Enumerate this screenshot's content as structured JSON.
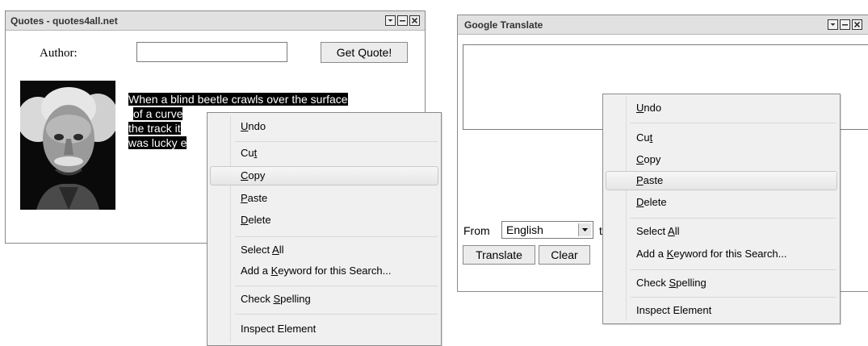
{
  "quotes_gadget": {
    "title": "Quotes - quotes4all.net",
    "author_label": "Author:",
    "author_value": "",
    "get_quote_label": "Get Quote!",
    "quote_lines": [
      "When a blind beetle crawls over the surface",
      "of a curved branch, it doesn't notice that",
      "the track it has covered is indeed curved. I",
      "was lucky enough to notice what the beetle"
    ],
    "visible_quote_lines": [
      "When a blind beetle crawls over the surface",
      " of a curve",
      "the track it",
      "was lucky e"
    ],
    "photo_alt": "portrait"
  },
  "translate_gadget": {
    "title": "Google Translate",
    "source_text": "",
    "from_label": "From",
    "from_language": "English",
    "to_label_partial": "t",
    "translate_label": "Translate",
    "clear_label": "Clear"
  },
  "context_menu_left": {
    "items": [
      {
        "label": "Undo",
        "accel": "U"
      },
      {
        "label": "Cut",
        "accel": "t"
      },
      {
        "label": "Copy",
        "accel": "C"
      },
      {
        "label": "Paste",
        "accel": "P"
      },
      {
        "label": "Delete",
        "accel": "D"
      },
      {
        "label": "Select All",
        "accel": "A"
      },
      {
        "label": "Add a Keyword for this Search...",
        "accel": "K"
      },
      {
        "label": "Check Spelling",
        "accel": "S"
      },
      {
        "label": "Inspect Element",
        "accel": ""
      }
    ],
    "highlighted": "Copy"
  },
  "context_menu_right": {
    "items": [
      {
        "label": "Undo",
        "accel": "U"
      },
      {
        "label": "Cut",
        "accel": "t"
      },
      {
        "label": "Copy",
        "accel": "C"
      },
      {
        "label": "Paste",
        "accel": "P"
      },
      {
        "label": "Delete",
        "accel": "D"
      },
      {
        "label": "Select All",
        "accel": "A"
      },
      {
        "label": "Add a Keyword for this Search...",
        "accel": "K"
      },
      {
        "label": "Check Spelling",
        "accel": "S"
      },
      {
        "label": "Inspect Element",
        "accel": ""
      }
    ],
    "highlighted": "Paste"
  },
  "icons": {
    "window_controls": [
      "collapse-icon",
      "minimize-icon",
      "close-icon"
    ],
    "dropdown": "chevron-down-icon"
  },
  "colors": {
    "titlebar": "#e1e1e1",
    "menu_bg": "#f0f0f0",
    "highlight_text_bg": "#000000"
  }
}
